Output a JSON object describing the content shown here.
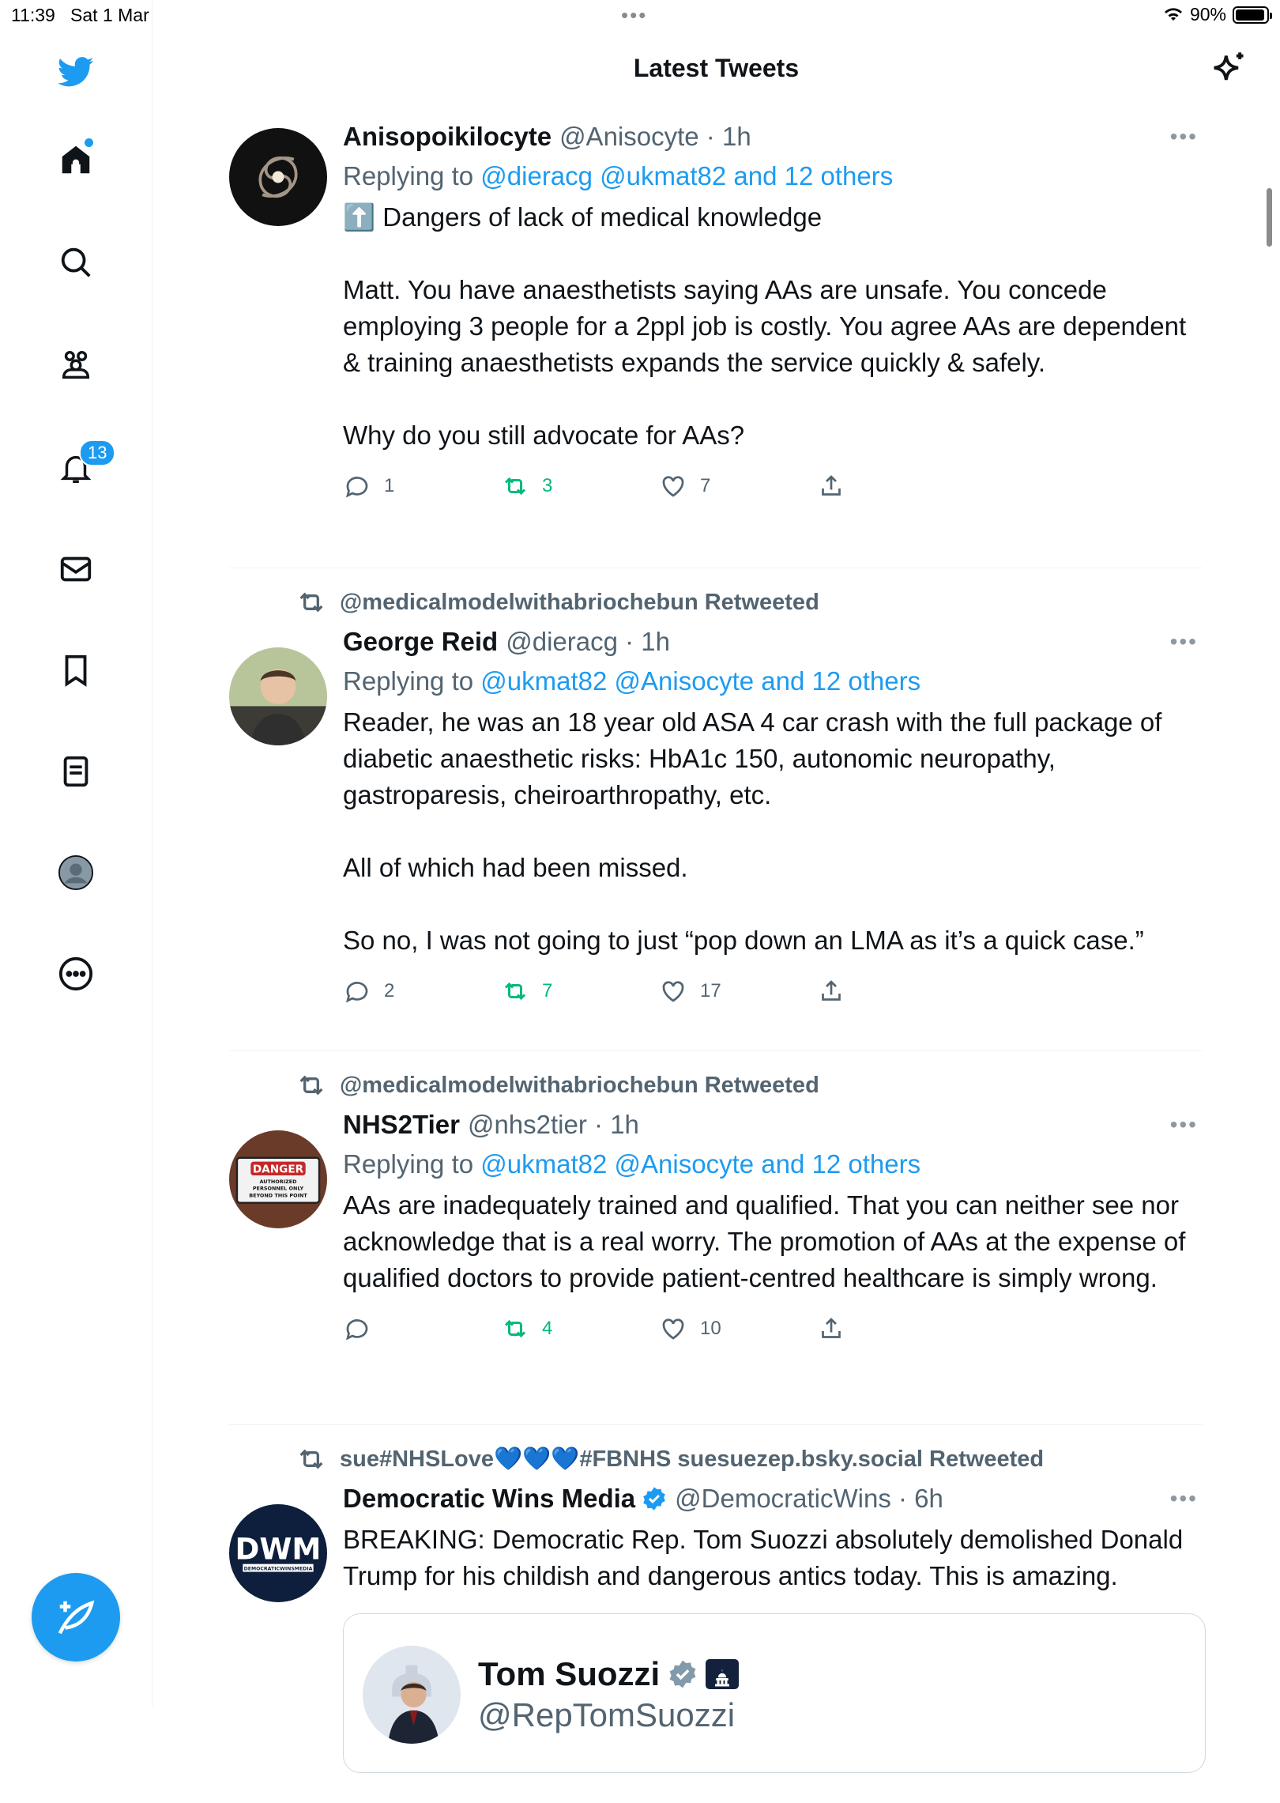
{
  "status_bar": {
    "time": "11:39",
    "date": "Sat 1 Mar",
    "battery": "90%"
  },
  "header": {
    "title": "Latest Tweets"
  },
  "sidebar": {
    "items": [
      {
        "name": "home",
        "icon": "home-icon"
      },
      {
        "name": "search",
        "icon": "search-icon"
      },
      {
        "name": "communities",
        "icon": "communities-icon"
      },
      {
        "name": "notifications",
        "icon": "bell-icon",
        "badge": "13"
      },
      {
        "name": "messages",
        "icon": "mail-icon"
      },
      {
        "name": "bookmarks",
        "icon": "bookmark-icon"
      },
      {
        "name": "lists",
        "icon": "lists-icon"
      },
      {
        "name": "profile",
        "icon": "profile-icon"
      },
      {
        "name": "more",
        "icon": "more-icon"
      }
    ],
    "accent": "#1d9bf0"
  },
  "tweets": [
    {
      "name": "Anisopoikilocyte",
      "handle": "@Anisocyte",
      "time": "1h",
      "reply_label": "Replying to",
      "reply_to": "@dieracg @ukmat82 and 12 others",
      "text": "⬆️ Dangers of lack of medical knowledge\n\nMatt. You have anaesthetists saying AAs are unsafe. You concede employing 3 people for a 2ppl job is costly. You agree AAs are dependent & training anaesthetists expands the service quickly & safely.\n\nWhy do you still advocate for AAs?",
      "replies": "1",
      "retweets": "3",
      "likes": "7"
    },
    {
      "retweeted_by": "@medicalmodelwithabriochebun Retweeted",
      "name": "George Reid",
      "handle": "@dieracg",
      "time": "1h",
      "reply_label": "Replying to",
      "reply_to": "@ukmat82 @Anisocyte and 12 others",
      "text": "Reader, he was an 18 year old ASA 4 car crash with the full package of diabetic anaesthetic risks: HbA1c 150, autonomic neuropathy, gastroparesis, cheiroarthropathy, etc.\n\nAll of which had been missed.\n\nSo no, I was not going to just “pop down an LMA as it’s a quick case.”",
      "replies": "2",
      "retweets": "7",
      "likes": "17"
    },
    {
      "retweeted_by": "@medicalmodelwithabriochebun Retweeted",
      "name": "NHS2Tier",
      "handle": "@nhs2tier",
      "time": "1h",
      "reply_label": "Replying to",
      "reply_to": "@ukmat82 @Anisocyte and 12 others",
      "text": "AAs are inadequately trained and qualified. That you can neither see nor acknowledge that is a real worry. The promotion of AAs at the expense of qualified doctors to provide patient-centred healthcare is simply wrong.",
      "avatar_sign": "DANGER",
      "avatar_sign_sub": "AUTHORIZED PERSONNEL ONLY BEYOND THIS POINT",
      "replies": "",
      "retweets": "4",
      "likes": "10"
    },
    {
      "retweeted_by": "sue#NHSLove💙💙💙#FBNHS suesuezep.bsky.social Retweeted",
      "name": "Democratic Wins Media",
      "handle": "@DemocraticWins",
      "time": "6h",
      "avatar_logo": "DWM",
      "avatar_logo_sub": "DEMOCRATICWINSMEDIA",
      "text": "BREAKING: Democratic Rep. Tom Suozzi absolutely demolished Donald Trump for his childish and dangerous antics today. This is amazing.",
      "quote": {
        "name": "Tom Suozzi",
        "handle": "@RepTomSuozzi"
      }
    }
  ]
}
